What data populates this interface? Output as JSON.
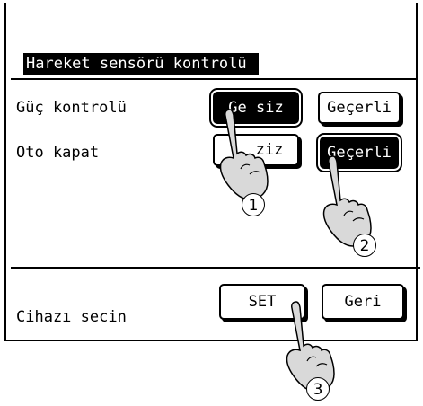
{
  "panel": {
    "title": "Hareket sensörü kontrolü",
    "rows": [
      {
        "label": "Güç kontrolü",
        "left_option": "Ge siz",
        "right_option": "Geçerli",
        "selected": "left"
      },
      {
        "label": "Oto kapat",
        "left_option": "ziz",
        "right_option": "Geçerli",
        "selected": "right"
      }
    ]
  },
  "footer": {
    "prompt": "Cihazı secin",
    "set_label": "SET",
    "back_label": "Geri"
  },
  "steps": [
    "1",
    "2",
    "3"
  ]
}
